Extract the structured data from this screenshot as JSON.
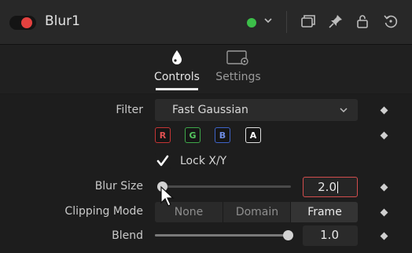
{
  "header": {
    "tool_name": "Blur1",
    "icons": [
      "enable-toggle",
      "status-green-dot",
      "chevron-down-icon",
      "versions-icon",
      "pin-icon",
      "lock-icon",
      "reset-icon"
    ]
  },
  "tabs": [
    {
      "label": "Controls",
      "icon": "drop-icon",
      "active": true
    },
    {
      "label": "Settings",
      "icon": "settings-icon",
      "active": false
    }
  ],
  "controls": {
    "filter": {
      "label": "Filter",
      "value": "Fast Gaussian"
    },
    "channels": [
      "R",
      "G",
      "B",
      "A"
    ],
    "lock_xy": {
      "label": "Lock X/Y",
      "checked": true
    },
    "blur_size": {
      "label": "Blur Size",
      "value": "2.0",
      "slider_fraction": 0.0
    },
    "clipping_mode": {
      "label": "Clipping Mode",
      "options": [
        "None",
        "Domain",
        "Frame"
      ],
      "selected": "Frame"
    },
    "blend": {
      "label": "Blend",
      "value": "1.0",
      "slider_fraction": 1.0
    }
  },
  "colors": {
    "accent_red": "#e3413f",
    "status_green": "#3cbf49",
    "channel_r": "#c53535",
    "channel_g": "#3fa84a",
    "channel_b": "#3f64c9"
  }
}
